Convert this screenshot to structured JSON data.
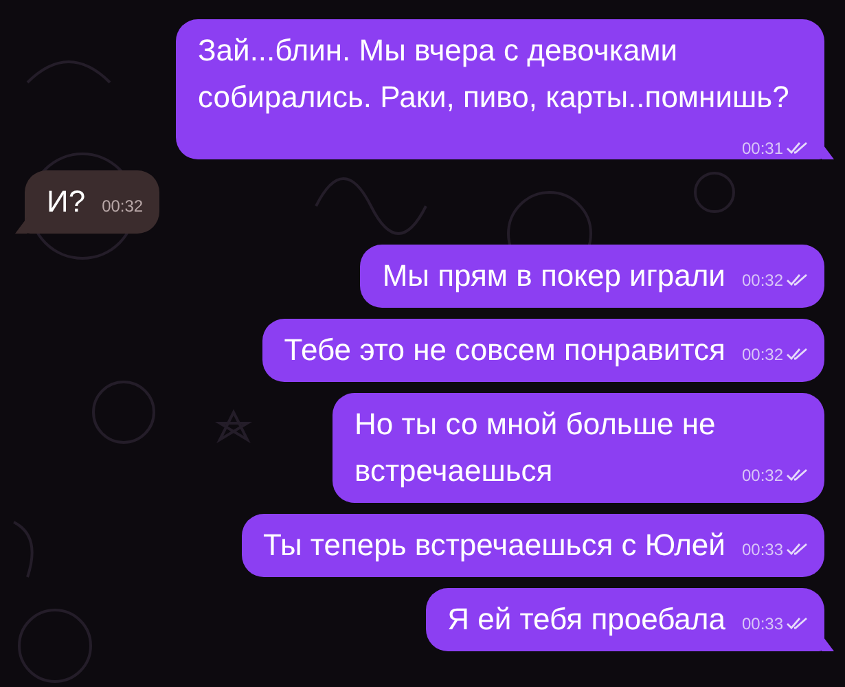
{
  "messages": [
    {
      "outgoing": true,
      "text": "Зай...блин. Мы вчера с девочками собирались. Раки, пиво, карты..помнишь?",
      "time": "00:31",
      "read": true,
      "tail": true
    },
    {
      "outgoing": false,
      "text": "И?",
      "time": "00:32",
      "tail": true
    },
    {
      "outgoing": true,
      "text": "Мы прям в покер играли",
      "time": "00:32",
      "read": true,
      "tail": false
    },
    {
      "outgoing": true,
      "text": "Тебе это не совсем понравится",
      "time": "00:32",
      "read": true,
      "tail": false
    },
    {
      "outgoing": true,
      "text": "Но ты со мной больше не встречаешься",
      "time": "00:32",
      "read": true,
      "tail": false
    },
    {
      "outgoing": true,
      "text": "Ты теперь встречаешься с Юлей",
      "time": "00:33",
      "read": true,
      "tail": false
    },
    {
      "outgoing": true,
      "text": "Я ей тебя проебала",
      "time": "00:33",
      "read": true,
      "tail": true
    }
  ]
}
